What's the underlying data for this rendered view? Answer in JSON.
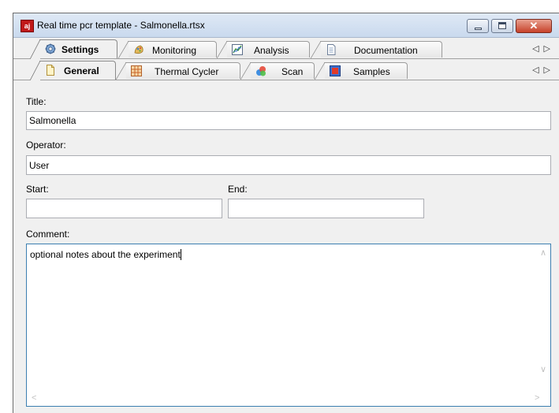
{
  "window": {
    "title": "Real time pcr template - Salmonella.rtsx",
    "app_icon_text": "aj",
    "controls": {
      "minimize": "minimize-icon",
      "maximize": "maximize-icon",
      "close": "close-icon"
    }
  },
  "main_tabs": [
    {
      "label": "Settings",
      "icon": "gear-icon",
      "active": true
    },
    {
      "label": "Monitoring",
      "icon": "monitoring-icon",
      "active": false
    },
    {
      "label": "Analysis",
      "icon": "analysis-chart-icon",
      "active": false
    },
    {
      "label": "Documentation",
      "icon": "document-icon",
      "active": false
    }
  ],
  "sub_tabs": [
    {
      "label": "General",
      "icon": "general-page-icon",
      "active": true
    },
    {
      "label": "Thermal Cycler",
      "icon": "thermal-cycler-grid-icon",
      "active": false
    },
    {
      "label": "Scan",
      "icon": "scan-icon",
      "active": false
    },
    {
      "label": "Samples",
      "icon": "samples-icon",
      "active": false
    }
  ],
  "form": {
    "title_label": "Title:",
    "title_value": "Salmonella",
    "operator_label": "Operator:",
    "operator_value": "User",
    "start_label": "Start:",
    "start_value": "",
    "end_label": "End:",
    "end_value": "",
    "comment_label": "Comment:",
    "comment_value": "optional notes about the experiment"
  },
  "colors": {
    "focus_border": "#3c7fb1",
    "close_button": "#c7412a",
    "app_icon": "#c01818"
  }
}
